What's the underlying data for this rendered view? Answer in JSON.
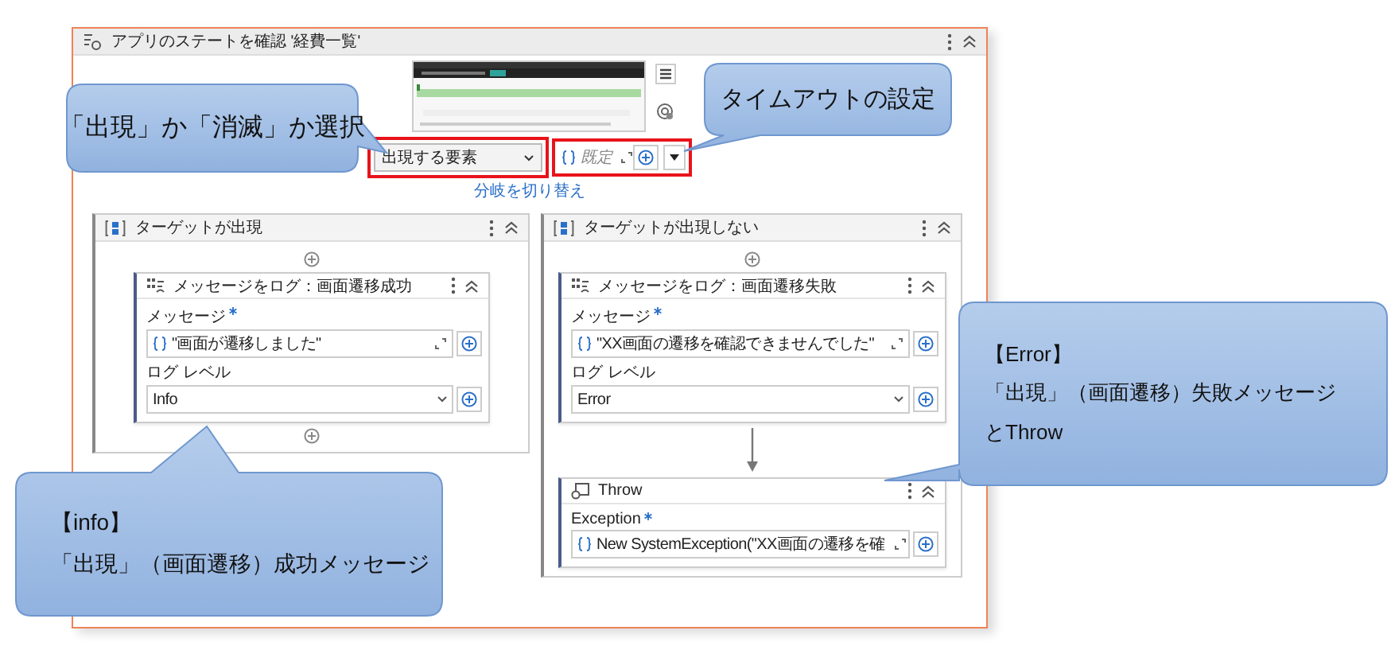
{
  "activity": {
    "title": "アプリのステートを確認 '経費一覧'"
  },
  "target": {
    "value": "出現する要素"
  },
  "timeout": {
    "placeholder": "既定"
  },
  "switch_link": "分岐を切り替え",
  "branches": [
    {
      "title": "ターゲットが出現",
      "activities": [
        {
          "kind": "log",
          "title": "メッセージをログ：画面遷移成功",
          "fields": [
            {
              "kind": "expression",
              "label": "メッセージ",
              "required": true,
              "value": "\"画面が遷移しました\""
            },
            {
              "kind": "select",
              "label": "ログ レベル",
              "required": false,
              "value": "Info"
            }
          ]
        }
      ]
    },
    {
      "title": "ターゲットが出現しない",
      "activities": [
        {
          "kind": "log",
          "title": "メッセージをログ：画面遷移失敗",
          "fields": [
            {
              "kind": "expression",
              "label": "メッセージ",
              "required": true,
              "value": "\"XX画面の遷移を確認できませんでした\""
            },
            {
              "kind": "select",
              "label": "ログ レベル",
              "required": false,
              "value": "Error"
            }
          ]
        },
        {
          "kind": "throw",
          "title": "Throw",
          "fields": [
            {
              "kind": "expression",
              "label": "Exception",
              "required": true,
              "value": "New SystemException(\"XX画面の遷移を確"
            }
          ]
        }
      ]
    }
  ],
  "callouts": [
    {
      "lines": [
        "「出現」か「消滅」か選択"
      ]
    },
    {
      "lines": [
        "タイムアウトの設定"
      ]
    },
    {
      "lines": [
        "【Error】",
        "「出現」（画面遷移）失敗メッセージ",
        "とThrow"
      ]
    },
    {
      "lines": [
        "【info】",
        "「出現」（画面遷移）成功メッセージ"
      ]
    }
  ]
}
